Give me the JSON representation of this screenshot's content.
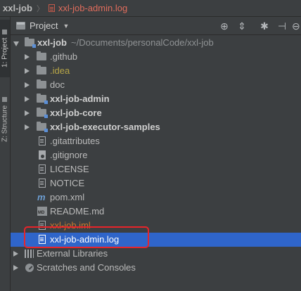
{
  "breadcrumb": {
    "root": "xxl-job",
    "separator": "〉",
    "file": "xxl-job-admin.log"
  },
  "side_tabs": {
    "project": "1: Project",
    "structure": "Z: Structure"
  },
  "project_panel": {
    "title": "Project",
    "icons": [
      "crosshair-icon",
      "collapse-icon",
      "gear-icon",
      "hide-icon"
    ]
  },
  "tree": {
    "root": {
      "name": "xxl-job",
      "path": "~/Documents/personalCode/xxl-job"
    },
    "items": [
      {
        "name": ".github",
        "type": "folder"
      },
      {
        "name": ".idea",
        "type": "folder"
      },
      {
        "name": "doc",
        "type": "folder"
      },
      {
        "name": "xxl-job-admin",
        "type": "module"
      },
      {
        "name": "xxl-job-core",
        "type": "module"
      },
      {
        "name": "xxl-job-executor-samples",
        "type": "module"
      },
      {
        "name": ".gitattributes",
        "type": "file"
      },
      {
        "name": ".gitignore",
        "type": "file"
      },
      {
        "name": "LICENSE",
        "type": "file"
      },
      {
        "name": "NOTICE",
        "type": "file"
      },
      {
        "name": "pom.xml",
        "type": "maven"
      },
      {
        "name": "README.md",
        "type": "markdown"
      },
      {
        "name": "xxl-job.iml",
        "type": "iml"
      },
      {
        "name": "xxl-job-admin.log",
        "type": "log",
        "selected": true
      }
    ],
    "external_libraries": "External Libraries",
    "scratches": "Scratches and Consoles"
  },
  "colors": {
    "background": "#3c3f41",
    "selection": "#2f65ca",
    "highlight_box": "#e8242a",
    "idea_folder": "#b7a547",
    "iml_file": "#c8782e"
  }
}
